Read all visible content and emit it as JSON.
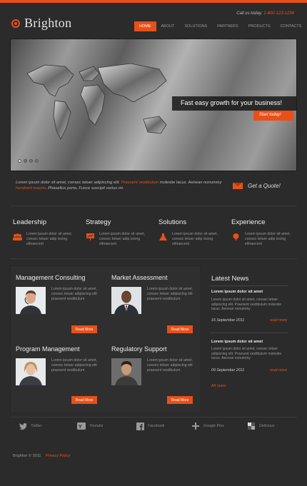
{
  "brand": {
    "name": "Brighton",
    "accent": "#e8501a"
  },
  "header": {
    "call_label": "Call us today:",
    "phone": "1-800-123-1234"
  },
  "nav": [
    "HOME",
    "ABOUT",
    "SOLUTIONS",
    "PARTNERS",
    "PRODUCTS",
    "CONTACTS"
  ],
  "slider": {
    "caption": "Fast easy growth for your business!",
    "button": "Start today!",
    "slides": 4,
    "active_slide": 1
  },
  "intro": {
    "text1": "Lorem ipsum dolor sit amet, consec tetuer adipiscing elit. ",
    "link1": "Praesent vestibulum",
    "text2": " molestie lacus. Aenean nonummy ",
    "link2": "hendrerit mauris",
    "text3": ". Phasellus porta. Fusce suscipit varius mi."
  },
  "quote": {
    "label": "Get a Quote!",
    "icon": "envelope-icon"
  },
  "features": [
    {
      "title": "Leadership",
      "text": "Lorem ipsum dolor sit amet, consec tetuer adip iscing elitraecent",
      "icon": "people-icon"
    },
    {
      "title": "Strategy",
      "text": "Lorem ipsum dolor sit amet, consec tetuer adip iscing elitraecent",
      "icon": "presentation-icon"
    },
    {
      "title": "Solutions",
      "text": "Lorem ipsum dolor sit amet, consec tetuer adip iscing elitraecent",
      "icon": "flask-icon"
    },
    {
      "title": "Experience",
      "text": "Lorem ipsum dolor sit amet, consec tetuer adip iscing elitraecent",
      "icon": "tree-icon"
    }
  ],
  "services": [
    {
      "title": "Management Consulting",
      "text": "Lorem ipsum dolor sit amet, consec tetuer adipiscing elit praesent vestibulum",
      "button": "Read More"
    },
    {
      "title": "Market Assessment",
      "text": "Lorem ipsum dolor sit amet, consec tetuer adipiscing elit praesent vestibulum",
      "button": "Read More"
    },
    {
      "title": "Program Management",
      "text": "Lorem ipsum dolor sit amet, consec tetuer adipiscing elit praesent vestibulum",
      "button": "Read More"
    },
    {
      "title": "Regulatory Support",
      "text": "Lorem ipsum dolor sit amet, consec tetuer adipiscing elit praesent vestibulum",
      "button": "Read More"
    }
  ],
  "news": {
    "title": "Latest News",
    "items": [
      {
        "title": "Lorem ipsum dolor sit amet",
        "text": "Lorem ipsum dolor sit amet, consec tetuer adipiscing elit. Praesent vestibulum molestie lacus. Aenean nonummy",
        "date": "16 September 2011",
        "more": "read more"
      },
      {
        "title": "Lorem ipsum dolor sit amet",
        "text": "Lorem ipsum dolor sit amet, consec tetuer adipiscing elit. Praesent vestibulum molestie lacus. Aenean nonummy",
        "date": "09 September 2011",
        "more": "read more"
      }
    ],
    "all": "All news"
  },
  "social": [
    {
      "label": "Twitter",
      "icon": "twitter-icon"
    },
    {
      "label": "Youtube",
      "icon": "youtube-icon"
    },
    {
      "label": "Facebook",
      "icon": "facebook-icon"
    },
    {
      "label": "Google Plus",
      "icon": "google-plus-icon"
    },
    {
      "label": "Delicious",
      "icon": "delicious-icon"
    }
  ],
  "footer": {
    "copyright": "Brighton © 2011",
    "privacy": "Privacy Policy"
  }
}
